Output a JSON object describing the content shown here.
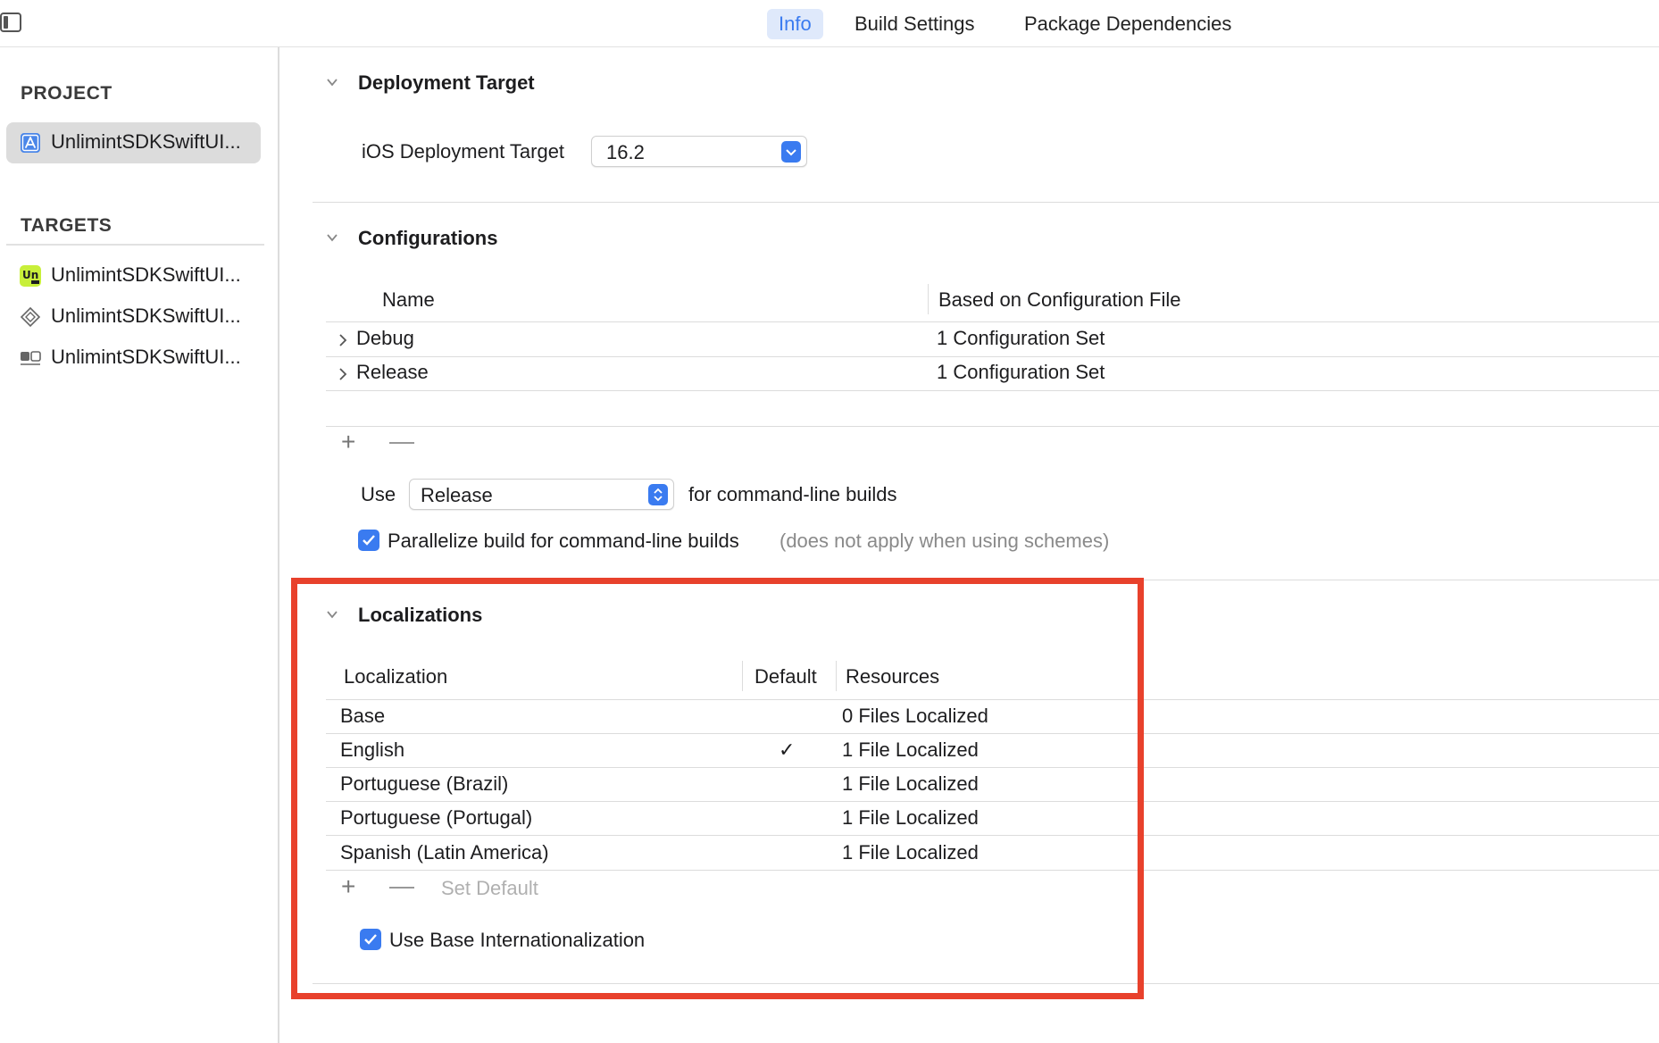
{
  "tabs": [
    {
      "label": "Info",
      "active": true
    },
    {
      "label": "Build Settings",
      "active": false
    },
    {
      "label": "Package Dependencies",
      "active": false
    }
  ],
  "sidebar": {
    "project_header": "PROJECT",
    "project_item": "UnlimintSDKSwiftUI...",
    "targets_header": "TARGETS",
    "targets": [
      {
        "label": "UnlimintSDKSwiftUI...",
        "icon": "app-icon"
      },
      {
        "label": "UnlimintSDKSwiftUI...",
        "icon": "test-diamond-icon"
      },
      {
        "label": "UnlimintSDKSwiftUI...",
        "icon": "ui-test-icon"
      }
    ]
  },
  "deployment": {
    "title": "Deployment Target",
    "label": "iOS Deployment Target",
    "value": "16.2"
  },
  "configurations": {
    "title": "Configurations",
    "col_name": "Name",
    "col_file": "Based on Configuration File",
    "rows": [
      {
        "name": "Debug",
        "file": "1 Configuration Set"
      },
      {
        "name": "Release",
        "file": "1 Configuration Set"
      }
    ],
    "use_label": "Use",
    "use_value": "Release",
    "use_suffix": "for command-line builds",
    "parallelize_label": "Parallelize build for command-line builds",
    "parallelize_note": "(does not apply when using schemes)",
    "parallelize_checked": true
  },
  "localizations": {
    "title": "Localizations",
    "col_localization": "Localization",
    "col_default": "Default",
    "col_resources": "Resources",
    "rows": [
      {
        "name": "Base",
        "default": "",
        "resources": "0 Files Localized"
      },
      {
        "name": "English",
        "default": "✓",
        "resources": "1 File Localized"
      },
      {
        "name": "Portuguese (Brazil)",
        "default": "",
        "resources": "1 File Localized"
      },
      {
        "name": "Portuguese (Portugal)",
        "default": "",
        "resources": "1 File Localized"
      },
      {
        "name": "Spanish (Latin America)",
        "default": "",
        "resources": "1 File Localized"
      }
    ],
    "set_default": "Set Default",
    "base_intl_label": "Use Base Internationalization",
    "base_intl_checked": true
  },
  "colors": {
    "accent": "#3a7bf0",
    "highlight": "#e8412c"
  }
}
